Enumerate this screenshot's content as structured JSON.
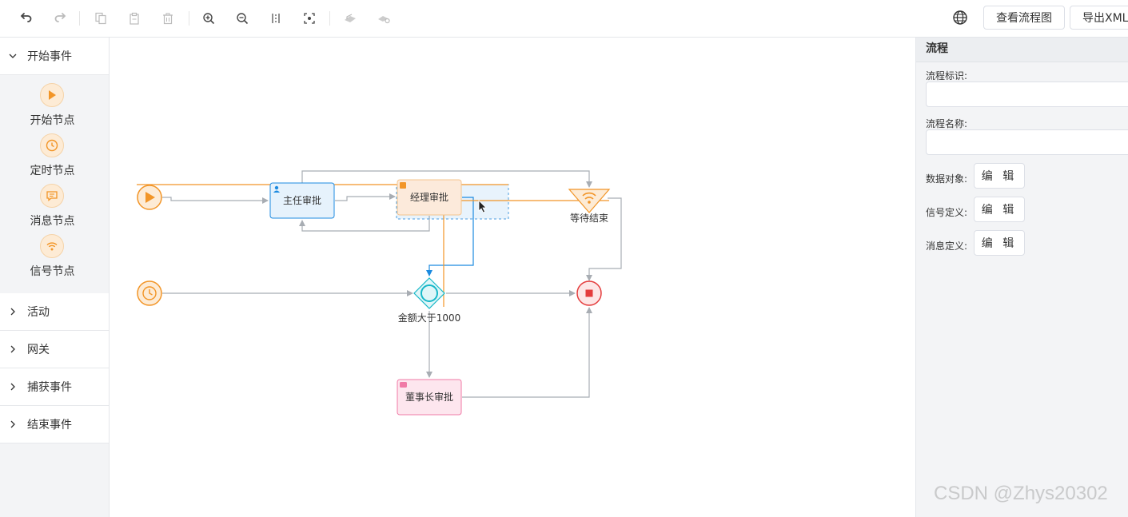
{
  "toolbar": {
    "icons": [
      "undo-icon",
      "redo-icon",
      "copy-icon",
      "paste-icon",
      "delete-icon",
      "zoom-in-icon",
      "zoom-out-icon",
      "align-icon",
      "fit-icon",
      "deploy-icon",
      "suspend-icon"
    ],
    "view_diagram_label": "查看流程图",
    "export_xml_label": "导出XML",
    "language_icon": "globe-icon"
  },
  "palette": {
    "categories": [
      {
        "label": "开始事件",
        "expanded": true
      },
      {
        "label": "活动",
        "expanded": false
      },
      {
        "label": "网关",
        "expanded": false
      },
      {
        "label": "捕获事件",
        "expanded": false
      },
      {
        "label": "结束事件",
        "expanded": false
      }
    ],
    "start_items": [
      {
        "label": "开始节点",
        "icon": "play-icon"
      },
      {
        "label": "定时节点",
        "icon": "clock-icon"
      },
      {
        "label": "消息节点",
        "icon": "message-icon"
      },
      {
        "label": "信号节点",
        "icon": "signal-icon"
      }
    ]
  },
  "diagram": {
    "nodes": {
      "task_director": "主任审批",
      "task_manager": "经理审批",
      "signal_end": "等待结束",
      "gateway": "金额大于1000",
      "task_chairman": "董事长审批"
    },
    "colors": {
      "orange": "#f29527",
      "blue": "#1c8ae0",
      "teal": "#17b8c8",
      "red": "#e43c3c",
      "pink": "#f07aa6",
      "connector": "#a8adb3"
    }
  },
  "properties": {
    "title": "流程",
    "fields": [
      {
        "label": "流程标识:",
        "value": ""
      },
      {
        "label": "流程名称:",
        "value": ""
      }
    ],
    "editors": [
      {
        "label": "数据对象:",
        "button": "编 辑"
      },
      {
        "label": "信号定义:",
        "button": "编 辑"
      },
      {
        "label": "消息定义:",
        "button": "编 辑"
      }
    ]
  },
  "watermark": "CSDN @Zhys20302"
}
